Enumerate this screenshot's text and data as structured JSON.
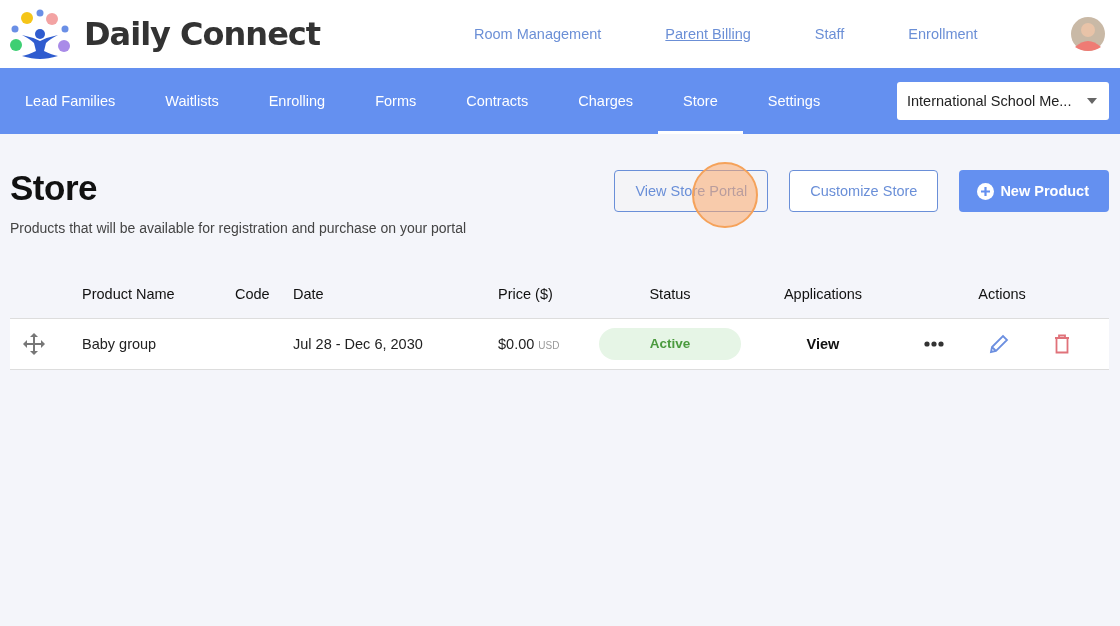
{
  "brand": {
    "name": "Daily Connect"
  },
  "top_nav": [
    {
      "label": "Room Management",
      "selected": false
    },
    {
      "label": "Parent Billing",
      "selected": true
    },
    {
      "label": "Staff",
      "selected": false
    },
    {
      "label": "Enrollment",
      "selected": false
    }
  ],
  "tabs": [
    {
      "label": "Lead Families",
      "selected": false
    },
    {
      "label": "Waitlists",
      "selected": false
    },
    {
      "label": "Enrolling",
      "selected": false
    },
    {
      "label": "Forms",
      "selected": false
    },
    {
      "label": "Contracts",
      "selected": false
    },
    {
      "label": "Charges",
      "selected": false
    },
    {
      "label": "Store",
      "selected": true
    },
    {
      "label": "Settings",
      "selected": false
    }
  ],
  "school_select": {
    "value": "International School Me..."
  },
  "page": {
    "title": "Store",
    "subtitle": "Products that will be available for registration and purchase on your portal"
  },
  "buttons": [
    {
      "label": "View Store Portal",
      "kind": "outline",
      "clicked": true
    },
    {
      "label": "Customize Store",
      "kind": "outline",
      "clicked": false
    },
    {
      "label": "New Product",
      "kind": "primary",
      "clicked": false
    }
  ],
  "table": {
    "columns": [
      "Product Name",
      "Code",
      "Date",
      "Price ($)",
      "Status",
      "Applications",
      "Actions"
    ],
    "rows": [
      {
        "name": "Baby group",
        "code": "",
        "date": "Jul 28 - Dec 6, 2030",
        "price": "$0.00",
        "currency": "USD",
        "status": "Active",
        "applications": "View"
      }
    ]
  }
}
